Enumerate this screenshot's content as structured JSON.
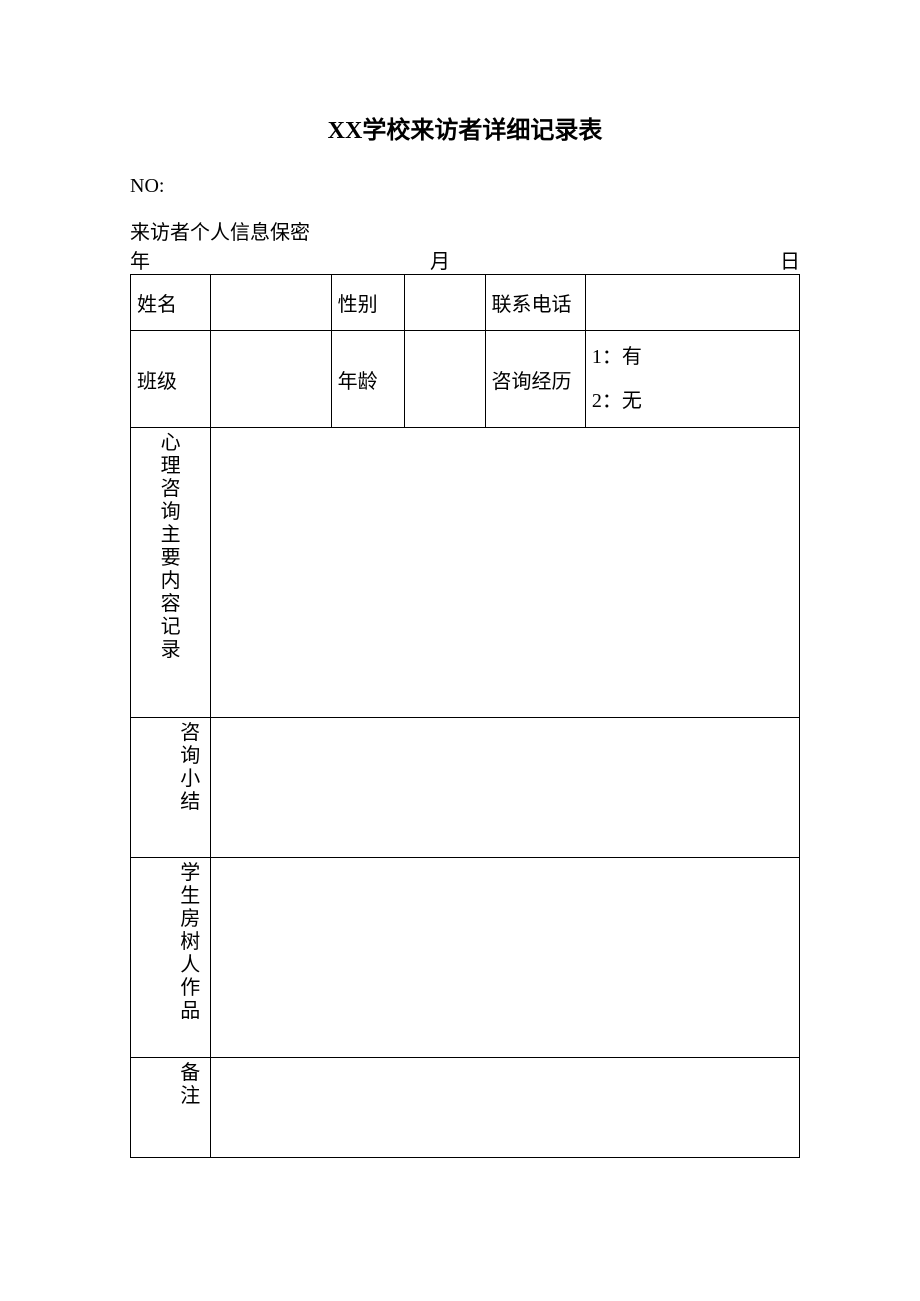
{
  "title": "XX学校来访者详细记录表",
  "no_label": "NO:",
  "confidential": "来访者个人信息保密",
  "date": {
    "year": "年",
    "month": "月",
    "day": "日"
  },
  "fields": {
    "name": "姓名",
    "gender": "性别",
    "phone": "联系电话",
    "class": "班级",
    "age": "年龄",
    "history": "咨询经历",
    "history_opt1": "1：有",
    "history_opt2": "2：无"
  },
  "sections": {
    "main_record": "心理咨询主要内容记录",
    "summary": "咨询小结",
    "htp": "学生房树人作品",
    "notes": "备注"
  }
}
